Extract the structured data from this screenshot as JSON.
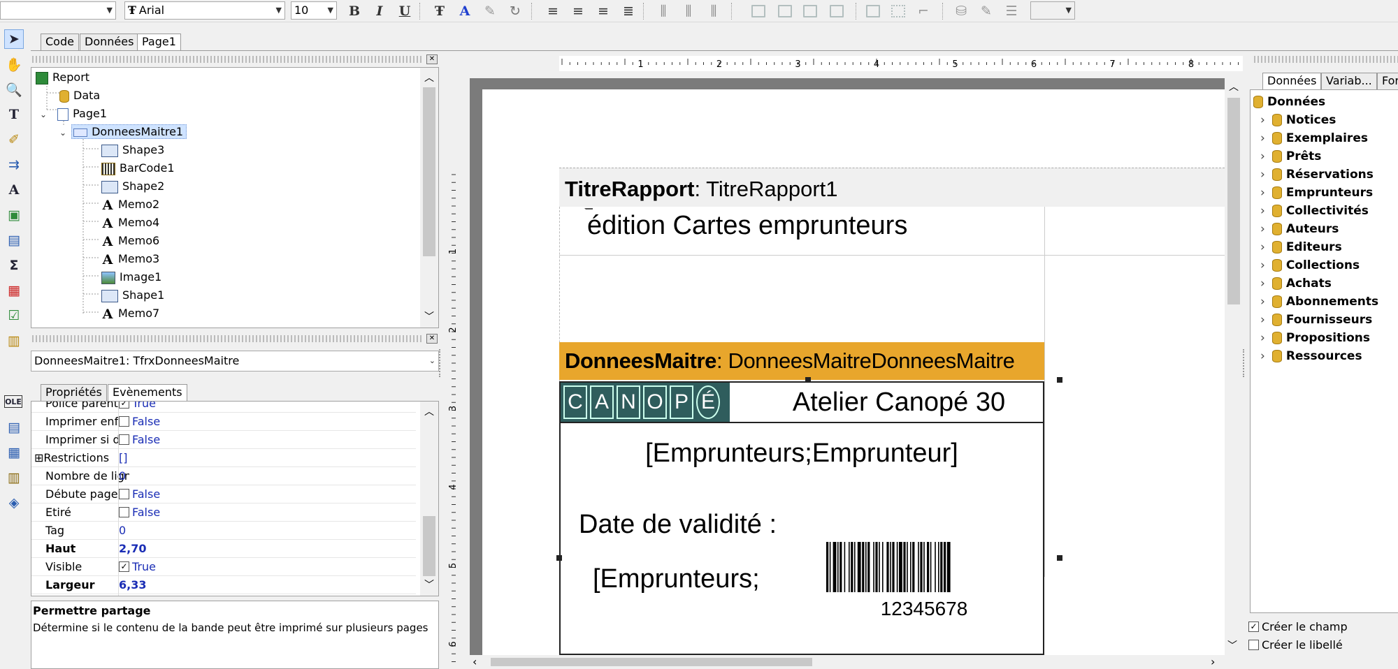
{
  "toolbar": {
    "style_value": "",
    "font_name": "Arial",
    "font_size": "10",
    "bold_label": "B",
    "italic_label": "I",
    "underline_label": "U"
  },
  "designer_tabs": [
    "Code",
    "Données",
    "Page1"
  ],
  "report_tree": {
    "items": [
      {
        "label": "Report",
        "icon": "report-icon"
      },
      {
        "label": "Data",
        "icon": "database-icon"
      },
      {
        "label": "Page1",
        "icon": "page-icon"
      },
      {
        "label": "DonneesMaitre1",
        "icon": "band-icon"
      },
      {
        "label": "Shape3",
        "icon": "shape-icon"
      },
      {
        "label": "BarCode1",
        "icon": "barcode-icon"
      },
      {
        "label": "Shape2",
        "icon": "shape-icon"
      },
      {
        "label": "Memo2",
        "icon": "memo-icon"
      },
      {
        "label": "Memo4",
        "icon": "memo-icon"
      },
      {
        "label": "Memo6",
        "icon": "memo-icon"
      },
      {
        "label": "Memo3",
        "icon": "memo-icon"
      },
      {
        "label": "Image1",
        "icon": "image-icon"
      },
      {
        "label": "Shape1",
        "icon": "shape-icon"
      },
      {
        "label": "Memo7",
        "icon": "memo-icon"
      }
    ]
  },
  "object_selector": {
    "value": "DonneesMaitre1: TfrxDonneesMaitre"
  },
  "inspector_tabs": [
    "Propriétés",
    "Evènements"
  ],
  "properties": [
    {
      "name": "Police parent",
      "value": "True",
      "check": true,
      "checked": true,
      "bold": false
    },
    {
      "name": "Imprimer enfant",
      "value": "False",
      "check": true,
      "checked": false,
      "bold": false
    },
    {
      "name": "Imprimer si détail",
      "value": "False",
      "check": true,
      "checked": false,
      "bold": false
    },
    {
      "name": "Restrictions",
      "value": "[]",
      "check": false,
      "checked": false,
      "bold": false,
      "expander": "⊞"
    },
    {
      "name": "Nombre de lignes",
      "value": "0",
      "check": false,
      "checked": false,
      "bold": false
    },
    {
      "name": "Débute page",
      "value": "False",
      "check": true,
      "checked": false,
      "bold": false
    },
    {
      "name": "Etiré",
      "value": "False",
      "check": true,
      "checked": false,
      "bold": false
    },
    {
      "name": "Tag",
      "value": "0",
      "check": false,
      "checked": false,
      "bold": false
    },
    {
      "name": "Haut",
      "value": "2,70",
      "check": false,
      "checked": false,
      "bold": true
    },
    {
      "name": "Visible",
      "value": "True",
      "check": true,
      "checked": true,
      "bold": false
    },
    {
      "name": "Largeur",
      "value": "6,33",
      "check": false,
      "checked": false,
      "bold": true
    }
  ],
  "help": {
    "title": "Permettre partage",
    "text": "Détermine si le contenu de la bande peut être imprimé sur plusieurs pages"
  },
  "ruler": {
    "marks": [
      "1",
      "2",
      "3",
      "4",
      "5",
      "6",
      "7",
      "8"
    ],
    "vmarks": [
      "1",
      "2",
      "3",
      "4",
      "5",
      "6"
    ]
  },
  "report": {
    "title_band_name": "TitreRapport",
    "title_band_instance": ": TitreRapport1",
    "title_memo": "édition Cartes emprunteurs",
    "master_band_name": "DonneesMaitre",
    "master_band_instance": ": DonneesMaitreDonneesMaitre",
    "logo_letters": [
      "C",
      "A",
      "N",
      "O",
      "P",
      "É"
    ],
    "atelier": "Atelier Canopé 30",
    "borrower_field": "[Emprunteurs;Emprunteur]",
    "validity_label": "Date de validité :",
    "borrower_field2": "[Emprunteurs;",
    "barcode_number": "12345678"
  },
  "right_tabs": [
    "Données",
    "Variab...",
    "For"
  ],
  "data_tree": {
    "root": "Données",
    "items": [
      "Notices",
      "Exemplaires",
      "Prêts",
      "Réservations",
      "Emprunteurs",
      "Collectivités",
      "Auteurs",
      "Editeurs",
      "Collections",
      "Achats",
      "Abonnements",
      "Fournisseurs",
      "Propositions",
      "Ressources"
    ]
  },
  "options": [
    {
      "label": "Créer le champ",
      "checked": true
    },
    {
      "label": "Créer le libellé",
      "checked": false
    }
  ],
  "colors": {
    "band_header": "#e8a62c",
    "logo_bg": "#2f5d5d",
    "selection": "#cfe3ff",
    "value_text": "#1a2db5"
  }
}
